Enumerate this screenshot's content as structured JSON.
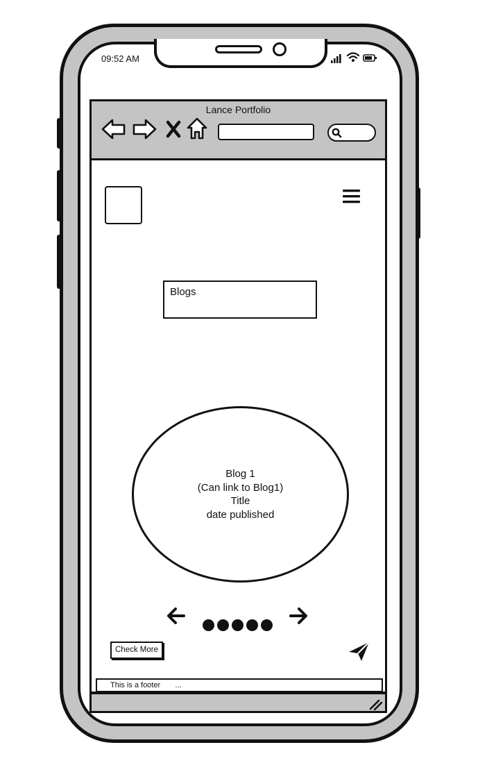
{
  "status_bar": {
    "time": "09:52 AM"
  },
  "browser": {
    "title": "Lance Portfolio",
    "url": "",
    "icons": [
      "back-arrow-icon",
      "forward-arrow-icon",
      "close-icon",
      "home-icon",
      "search-icon"
    ]
  },
  "page": {
    "heading": "Blogs",
    "blog_card": {
      "line1": "Blog 1",
      "line2": "(Can link to Blog1)",
      "line3": "Title",
      "line4": "date published"
    },
    "carousel": {
      "dot_count": 5
    },
    "check_more_label": "Check More",
    "footer_text": "This is a footer       ..."
  },
  "colors": {
    "frame_gray": "#c4c4c4",
    "ink": "#111111",
    "background": "#ffffff"
  }
}
